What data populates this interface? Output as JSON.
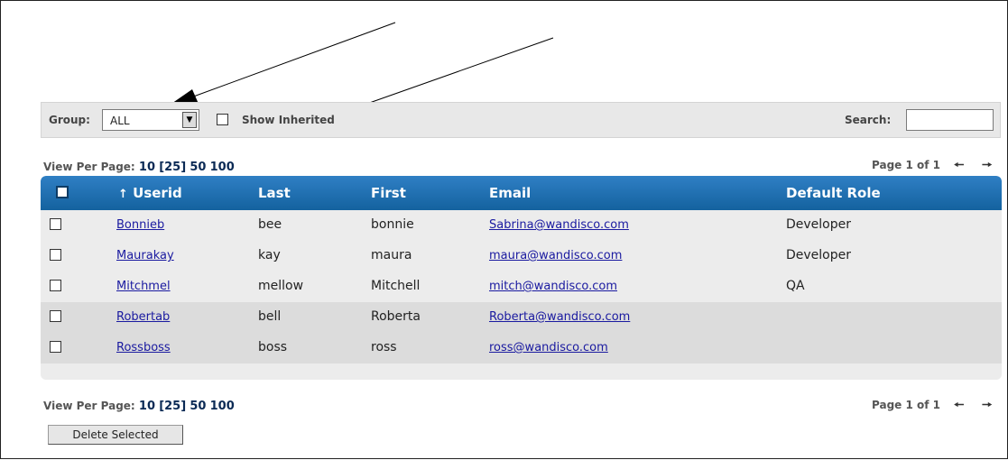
{
  "toolbar": {
    "group_label": "Group:",
    "group_value": "ALL",
    "show_inherited_label": "Show Inherited",
    "show_inherited_checked": false,
    "search_label": "Search:",
    "search_value": ""
  },
  "pager": {
    "view_label": "View Per Page:",
    "options": [
      "10",
      "[25]",
      "50",
      "100"
    ],
    "page_text": "Page 1 of 1"
  },
  "table": {
    "columns": [
      "Userid",
      "Last",
      "First",
      "Email",
      "Default Role"
    ],
    "sort_indicator": "↑",
    "rows": [
      {
        "userid": "Bonnieb",
        "last": "bee",
        "first": "bonnie",
        "email": "Sabrina@wandisco.com",
        "role": "Developer"
      },
      {
        "userid": "Maurakay",
        "last": "kay",
        "first": "maura",
        "email": "maura@wandisco.com",
        "role": "Developer"
      },
      {
        "userid": "Mitchmel",
        "last": "mellow",
        "first": "Mitchell",
        "email": "mitch@wandisco.com",
        "role": "QA"
      },
      {
        "userid": "Robertab",
        "last": "bell",
        "first": "Roberta",
        "email": "Roberta@wandisco.com",
        "role": ""
      },
      {
        "userid": "Rossboss",
        "last": "boss",
        "first": "ross",
        "email": "ross@wandisco.com",
        "role": ""
      }
    ]
  },
  "actions": {
    "delete_label": "Delete Selected"
  },
  "icons": {
    "prev": "arrow-left-icon",
    "next": "arrow-right-icon",
    "dropdown": "chevron-down-icon"
  }
}
